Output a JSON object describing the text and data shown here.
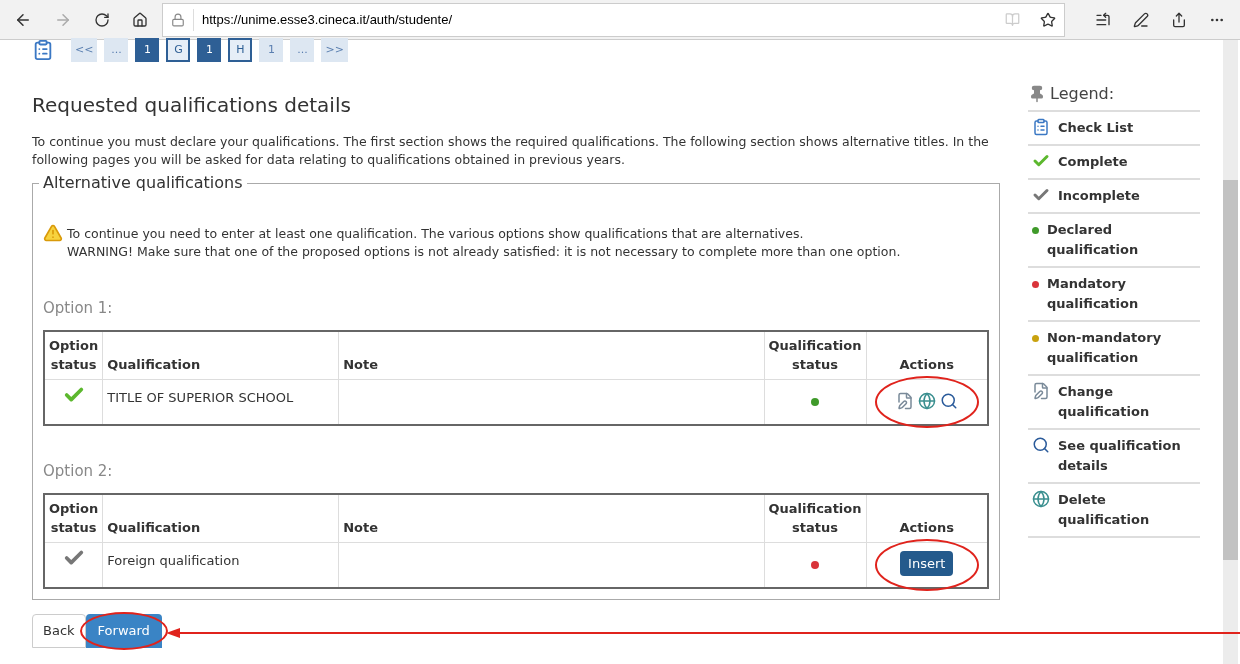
{
  "browser": {
    "url": "https://unime.esse3.cineca.it/auth/studente/"
  },
  "pager": [
    {
      "label": "<<",
      "kind": "plain"
    },
    {
      "label": "...",
      "kind": "plain"
    },
    {
      "label": "1",
      "kind": "filled"
    },
    {
      "label": "G",
      "kind": "outlined"
    },
    {
      "label": "1",
      "kind": "filled"
    },
    {
      "label": "H",
      "kind": "outlined"
    },
    {
      "label": "1",
      "kind": "plain"
    },
    {
      "label": "...",
      "kind": "plain"
    },
    {
      "label": ">>",
      "kind": "plain"
    }
  ],
  "heading": "Requested qualifications details",
  "intro": "To continue you must declare your qualifications. The first section shows the required qualifications. The following section shows alternative titles. In the following pages you will be asked for data relating to qualifications obtained in previous years.",
  "fieldset": {
    "legend": "Alternative qualifications",
    "warning": [
      "To continue you need to enter at least one qualification. The various options show qualifications that are alternatives.",
      "WARNING! Make sure that one of the proposed options is not already satisfied: it is not necessary to complete more than one option."
    ],
    "options": [
      {
        "label": "Option 1:",
        "columns": [
          "Option status",
          "Qualification",
          "Note",
          "Qualification status",
          "Actions"
        ],
        "rows": [
          {
            "complete": true,
            "qualification": "TITLE OF SUPERIOR SCHOOL",
            "color": "#3f9a2a",
            "actions": [
              {
                "kind": "edit"
              },
              {
                "kind": "delete"
              },
              {
                "kind": "view"
              }
            ],
            "circled": true
          }
        ]
      },
      {
        "label": "Option 2:",
        "columns": [
          "Option status",
          "Qualification",
          "Note",
          "Qualification status",
          "Actions"
        ],
        "rows": [
          {
            "complete": false,
            "qualification": "Foreign qualification",
            "color": "#d9343a",
            "actions": [
              {
                "kind": "button",
                "label": "Insert"
              }
            ],
            "circled": true
          }
        ]
      }
    ]
  },
  "buttons": [
    {
      "label": "Back",
      "kind": "secondary"
    },
    {
      "label": "Forward",
      "kind": "primary",
      "circled": true
    }
  ],
  "legend": {
    "title": "Legend:",
    "items": [
      {
        "kind": "checklist",
        "label": "Check List"
      },
      {
        "kind": "complete",
        "label": "Complete"
      },
      {
        "kind": "incomplete",
        "label": "Incomplete"
      },
      {
        "kind": "dot",
        "color": "#3f9a2a",
        "label": "Declared qualification"
      },
      {
        "kind": "dot",
        "color": "#d9343a",
        "label": "Mandatory qualification"
      },
      {
        "kind": "dot",
        "color": "#c9a20f",
        "label": "Non-mandatory qualification"
      },
      {
        "kind": "edit",
        "label": "Change qualification"
      },
      {
        "kind": "view",
        "label": "See qualification details"
      },
      {
        "kind": "delete",
        "label": "Delete qualification"
      }
    ]
  }
}
